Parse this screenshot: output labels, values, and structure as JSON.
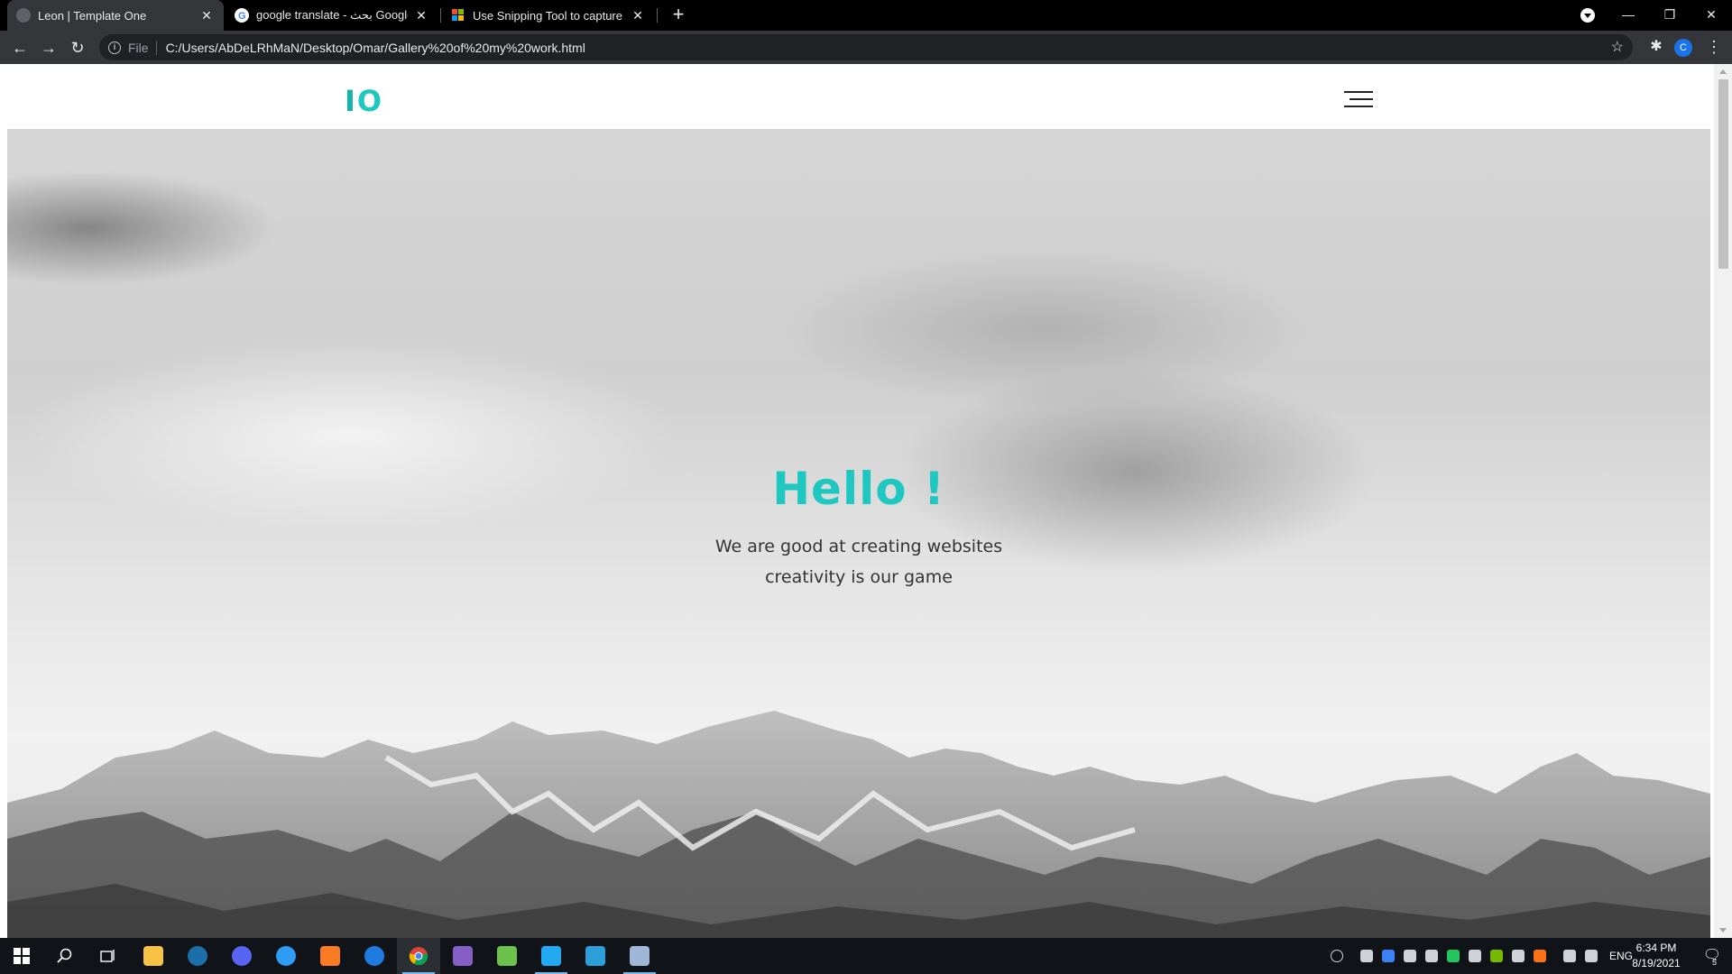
{
  "browser": {
    "tabs": [
      {
        "title": "Leon | Template One",
        "active": true
      },
      {
        "title": "google translate - بحث Google",
        "active": false
      },
      {
        "title": "Use Snipping Tool to capture scr",
        "active": false
      }
    ],
    "new_tab": "+",
    "window": {
      "minimize": "—",
      "restore": "❐",
      "close": "✕"
    },
    "nav": {
      "back": "←",
      "forward": "→",
      "reload": "↻"
    },
    "address": {
      "scheme": "File",
      "url": "C:/Users/AbDeLRhMaN/Desktop/Omar/Gallery%20of%20my%20work.html"
    },
    "profile_initial": "C"
  },
  "site": {
    "logo_part1": "I",
    "logo_part2": "O",
    "hero": {
      "title": "Hello !",
      "line1": "We are good at creating websites",
      "line2": "creativity is our game"
    },
    "accent_color": "#1ec8c0"
  },
  "taskbar": {
    "apps": [
      "start-icon",
      "search-icon",
      "task-view-icon",
      "file-explorer-icon",
      "steam-icon",
      "discord-icon",
      "messenger-icon",
      "xampp-icon",
      "edge-icon",
      "chrome-icon",
      "visual-studio-icon",
      "notepad-icon",
      "vscode-icon",
      "app-icon",
      "remote-desktop-icon"
    ],
    "language": "ENG",
    "time": "6:34 PM",
    "date": "8/19/2021",
    "notifications": "5"
  }
}
